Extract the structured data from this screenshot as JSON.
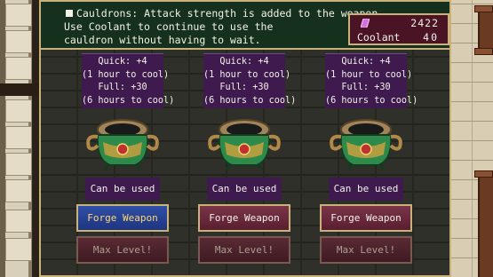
{
  "description": {
    "text": "Cauldrons: Attack strength is added to the weapon.\nUse Coolant to continue to use the\ncauldron without having to wait."
  },
  "stats": {
    "gem_value": "2422",
    "coolant_label": "Coolant",
    "coolant_value": "40"
  },
  "colors": {
    "frame_border": "#c9b27a",
    "header_bg": "#16301e",
    "panel_purple": "#3e1a4e",
    "button_active": "#1e3580",
    "button_text_active": "#ffd870"
  },
  "cauldrons": [
    {
      "quick": "Quick: +4",
      "quick_cool": "(1 hour to cool)",
      "full": "Full: +30",
      "full_cool": "(6 hours to cool)",
      "status": "Can be used",
      "forge_label": "Forge Weapon",
      "max_label": "Max Level!"
    },
    {
      "quick": "Quick: +4",
      "quick_cool": "(1 hour to cool)",
      "full": "Full: +30",
      "full_cool": "(6 hours to cool)",
      "status": "Can be used",
      "forge_label": "Forge Weapon",
      "max_label": "Max Level!"
    },
    {
      "quick": "Quick: +4",
      "quick_cool": "(1 hour to cool)",
      "full": "Full: +30",
      "full_cool": "(6 hours to cool)",
      "status": "Can be used",
      "forge_label": "Forge Weapon",
      "max_label": "Max Level!"
    }
  ]
}
